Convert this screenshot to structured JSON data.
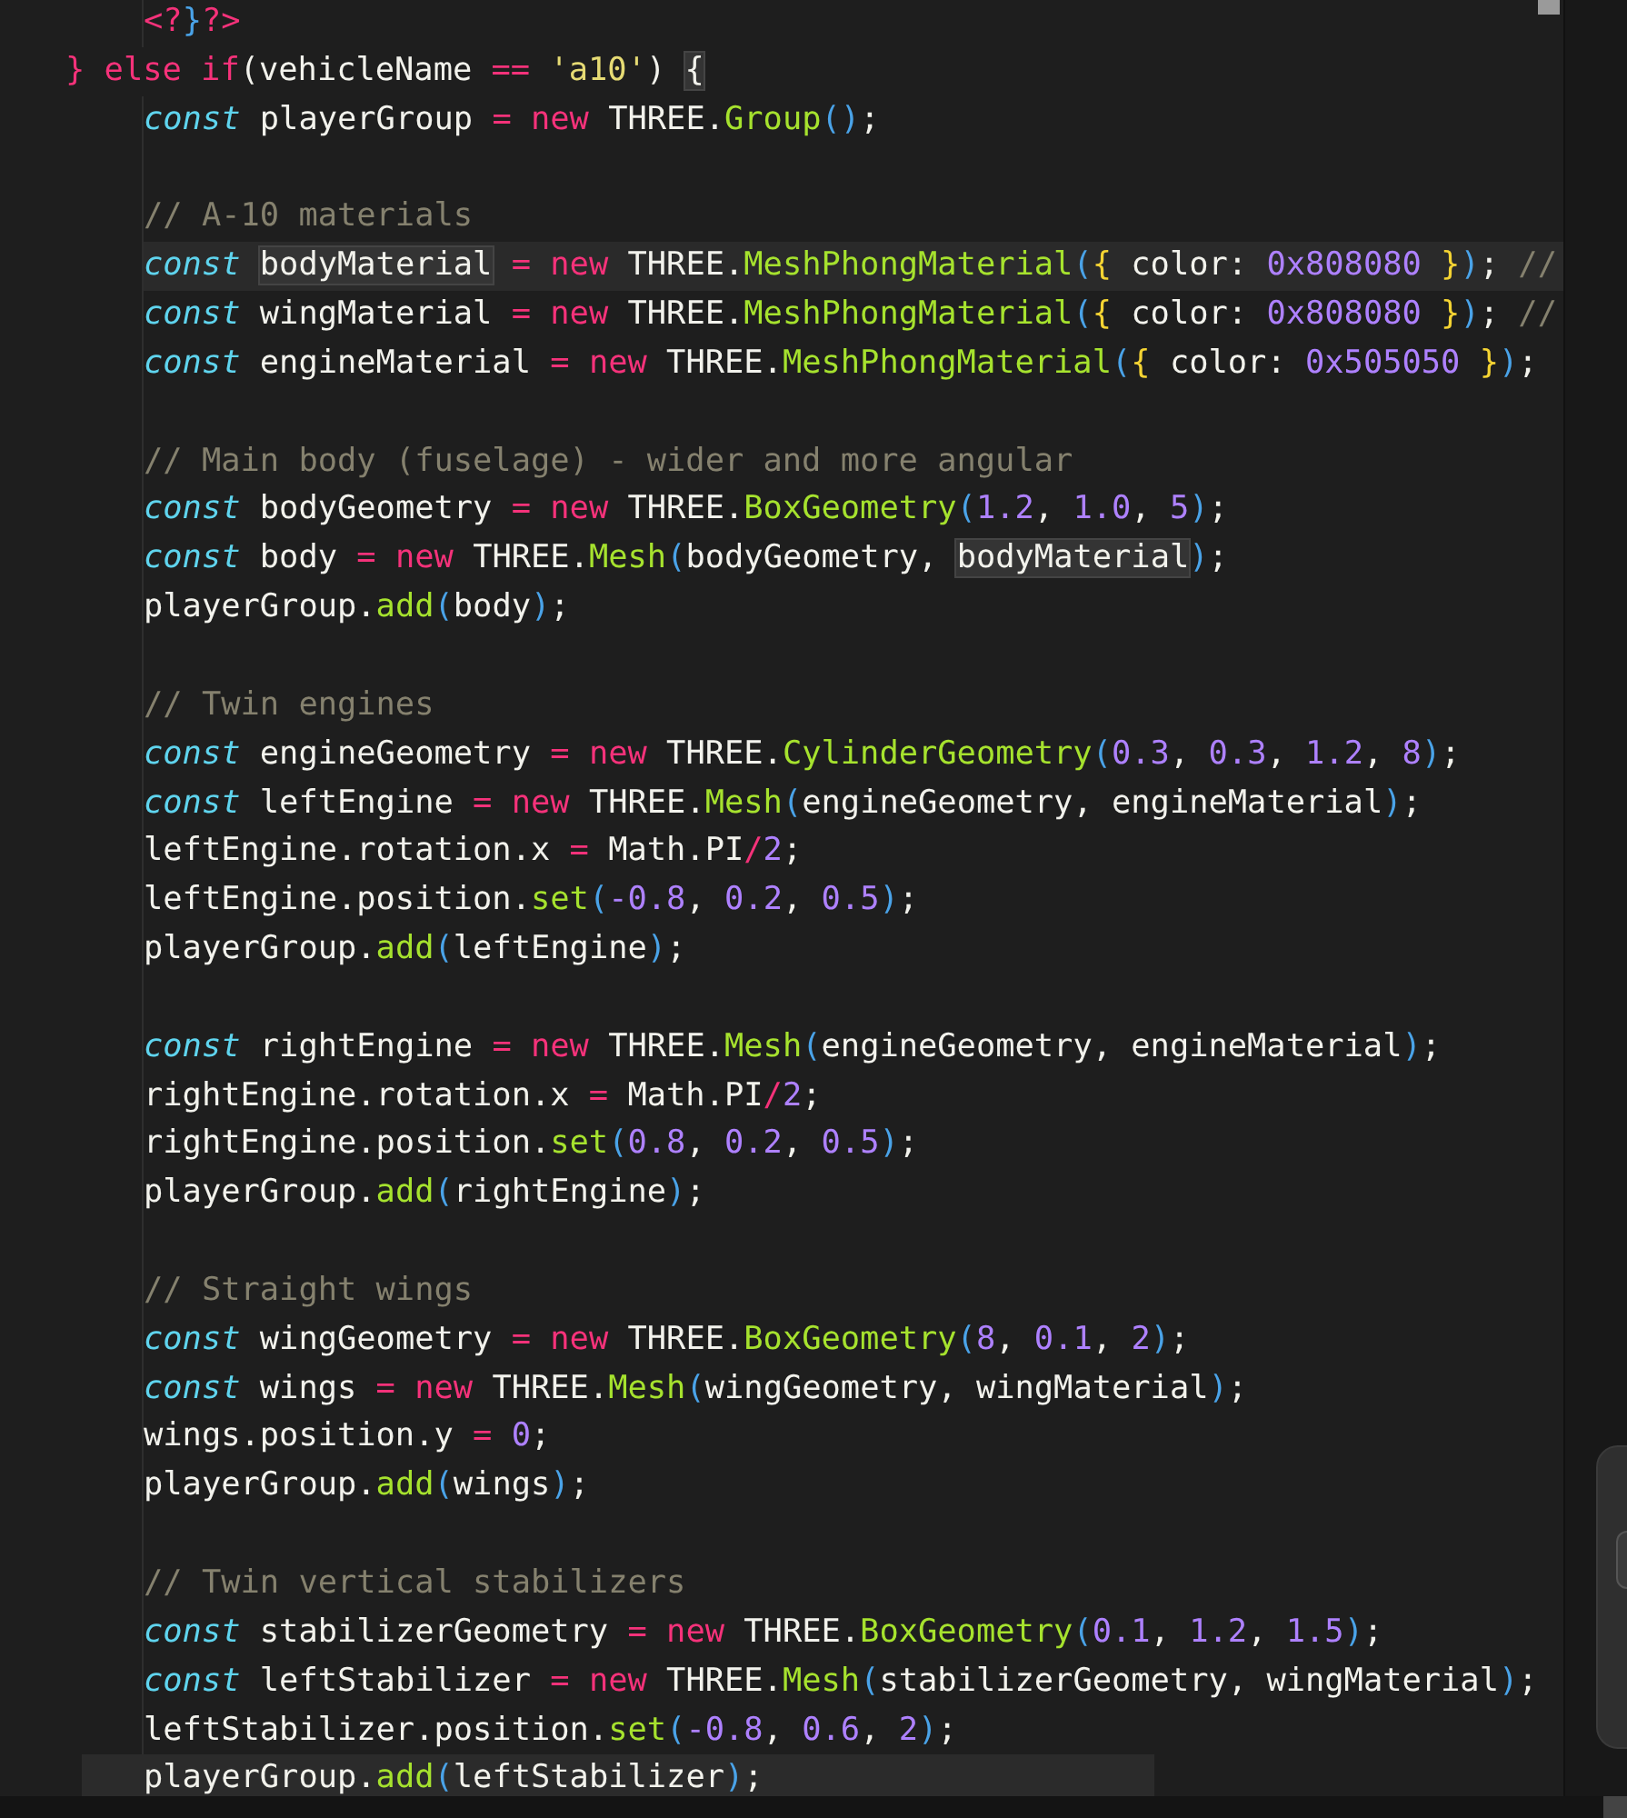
{
  "editor": {
    "preceding_block": [
      {
        "tokens": [
          {
            "t": "<?",
            "kind": "keyword"
          },
          {
            "t": "}",
            "kind": "paren"
          },
          {
            "t": "?>",
            "kind": "keyword"
          }
        ]
      }
    ],
    "lines": [
      {
        "tokens": [
          {
            "t": "} else if",
            "kind": "keyword"
          },
          {
            "t": "(vehicleName ",
            "kind": "plain"
          },
          {
            "t": "== ",
            "kind": "keyword"
          },
          {
            "t": "'a10'",
            "kind": "string"
          },
          {
            "t": ") ",
            "kind": "plain"
          },
          {
            "t": "{",
            "kind": "plain",
            "highlighted": true
          }
        ],
        "children": [
          {
            "tokens": [
              {
                "t": "const",
                "kind": "storage"
              },
              {
                "t": " playerGroup ",
                "kind": "plain"
              },
              {
                "t": "= ",
                "kind": "keyword"
              },
              {
                "t": "new",
                "kind": "keyword"
              },
              {
                "t": " THREE.",
                "kind": "plain"
              },
              {
                "t": "Group",
                "kind": "function"
              },
              {
                "t": "()",
                "kind": "paren"
              },
              {
                "t": ";",
                "kind": "plain"
              }
            ]
          },
          {
            "gap_before": true,
            "tokens": [
              {
                "t": "// A-10 materials",
                "kind": "comment"
              }
            ]
          },
          {
            "current_line": true,
            "tokens": [
              {
                "t": "const ",
                "kind": "storage"
              },
              {
                "t": "bodyMaterial",
                "kind": "plain",
                "highlighted": true
              },
              {
                "t": " = ",
                "kind": "keyword"
              },
              {
                "t": "new",
                "kind": "keyword"
              },
              {
                "t": " THREE.",
                "kind": "plain"
              },
              {
                "t": "MeshPhongMaterial",
                "kind": "function"
              },
              {
                "t": "(",
                "kind": "paren"
              },
              {
                "t": "{",
                "kind": "brace"
              },
              {
                "t": " color: ",
                "kind": "plain"
              },
              {
                "t": "0x808080 ",
                "kind": "number"
              },
              {
                "t": "}",
                "kind": "brace"
              },
              {
                "t": ")",
                "kind": "paren"
              },
              {
                "t": "; ",
                "kind": "plain"
              },
              {
                "t": "//",
                "kind": "comment"
              }
            ]
          },
          {
            "tokens": [
              {
                "t": "const",
                "kind": "storage"
              },
              {
                "t": " wingMaterial ",
                "kind": "plain"
              },
              {
                "t": "= ",
                "kind": "keyword"
              },
              {
                "t": "new",
                "kind": "keyword"
              },
              {
                "t": " THREE.",
                "kind": "plain"
              },
              {
                "t": "MeshPhongMaterial",
                "kind": "function"
              },
              {
                "t": "(",
                "kind": "paren"
              },
              {
                "t": "{",
                "kind": "brace"
              },
              {
                "t": " color: ",
                "kind": "plain"
              },
              {
                "t": "0x808080 ",
                "kind": "number"
              },
              {
                "t": "}",
                "kind": "brace"
              },
              {
                "t": ")",
                "kind": "paren"
              },
              {
                "t": "; ",
                "kind": "plain"
              },
              {
                "t": "//",
                "kind": "comment"
              }
            ]
          },
          {
            "tokens": [
              {
                "t": "const",
                "kind": "storage"
              },
              {
                "t": " engineMaterial ",
                "kind": "plain"
              },
              {
                "t": "= ",
                "kind": "keyword"
              },
              {
                "t": "new",
                "kind": "keyword"
              },
              {
                "t": " THREE.",
                "kind": "plain"
              },
              {
                "t": "MeshPhongMaterial",
                "kind": "function"
              },
              {
                "t": "(",
                "kind": "paren"
              },
              {
                "t": "{",
                "kind": "brace"
              },
              {
                "t": " color: ",
                "kind": "plain"
              },
              {
                "t": "0x505050 ",
                "kind": "number"
              },
              {
                "t": "}",
                "kind": "brace"
              },
              {
                "t": ")",
                "kind": "paren"
              },
              {
                "t": ";",
                "kind": "plain"
              }
            ]
          },
          {
            "gap_before": true,
            "tokens": [
              {
                "t": "// Main body (fuselage) - wider and more angular",
                "kind": "comment"
              }
            ]
          },
          {
            "tokens": [
              {
                "t": "const",
                "kind": "storage"
              },
              {
                "t": " bodyGeometry ",
                "kind": "plain"
              },
              {
                "t": "= ",
                "kind": "keyword"
              },
              {
                "t": "new",
                "kind": "keyword"
              },
              {
                "t": " THREE.",
                "kind": "plain"
              },
              {
                "t": "BoxGeometry",
                "kind": "function"
              },
              {
                "t": "(",
                "kind": "paren"
              },
              {
                "t": "1.2",
                "kind": "number"
              },
              {
                "t": ", ",
                "kind": "plain"
              },
              {
                "t": "1.0",
                "kind": "number"
              },
              {
                "t": ", ",
                "kind": "plain"
              },
              {
                "t": "5",
                "kind": "number"
              },
              {
                "t": ")",
                "kind": "paren"
              },
              {
                "t": ";",
                "kind": "plain"
              }
            ]
          },
          {
            "tokens": [
              {
                "t": "const",
                "kind": "storage"
              },
              {
                "t": " body ",
                "kind": "plain"
              },
              {
                "t": "= ",
                "kind": "keyword"
              },
              {
                "t": "new",
                "kind": "keyword"
              },
              {
                "t": " THREE.",
                "kind": "plain"
              },
              {
                "t": "Mesh",
                "kind": "function"
              },
              {
                "t": "(",
                "kind": "paren"
              },
              {
                "t": "bodyGeometry, ",
                "kind": "plain"
              },
              {
                "t": "bodyMaterial",
                "kind": "plain",
                "highlighted": true
              },
              {
                "t": ")",
                "kind": "paren"
              },
              {
                "t": ";",
                "kind": "plain"
              }
            ]
          },
          {
            "tokens": [
              {
                "t": "playerGroup.",
                "kind": "plain"
              },
              {
                "t": "add",
                "kind": "function"
              },
              {
                "t": "(",
                "kind": "paren"
              },
              {
                "t": "body",
                "kind": "plain"
              },
              {
                "t": ")",
                "kind": "paren"
              },
              {
                "t": ";",
                "kind": "plain"
              }
            ]
          },
          {
            "gap_before": true,
            "tokens": [
              {
                "t": "// Twin engines",
                "kind": "comment"
              }
            ]
          },
          {
            "tokens": [
              {
                "t": "const",
                "kind": "storage"
              },
              {
                "t": " engineGeometry ",
                "kind": "plain"
              },
              {
                "t": "= ",
                "kind": "keyword"
              },
              {
                "t": "new",
                "kind": "keyword"
              },
              {
                "t": " THREE.",
                "kind": "plain"
              },
              {
                "t": "CylinderGeometry",
                "kind": "function"
              },
              {
                "t": "(",
                "kind": "paren"
              },
              {
                "t": "0.3",
                "kind": "number"
              },
              {
                "t": ", ",
                "kind": "plain"
              },
              {
                "t": "0.3",
                "kind": "number"
              },
              {
                "t": ", ",
                "kind": "plain"
              },
              {
                "t": "1.2",
                "kind": "number"
              },
              {
                "t": ", ",
                "kind": "plain"
              },
              {
                "t": "8",
                "kind": "number"
              },
              {
                "t": ")",
                "kind": "paren"
              },
              {
                "t": ";",
                "kind": "plain"
              }
            ]
          },
          {
            "tokens": [
              {
                "t": "const",
                "kind": "storage"
              },
              {
                "t": " leftEngine ",
                "kind": "plain"
              },
              {
                "t": "= ",
                "kind": "keyword"
              },
              {
                "t": "new",
                "kind": "keyword"
              },
              {
                "t": " THREE.",
                "kind": "plain"
              },
              {
                "t": "Mesh",
                "kind": "function"
              },
              {
                "t": "(",
                "kind": "paren"
              },
              {
                "t": "engineGeometry, engineMaterial",
                "kind": "plain"
              },
              {
                "t": ")",
                "kind": "paren"
              },
              {
                "t": ";",
                "kind": "plain"
              }
            ]
          },
          {
            "tokens": [
              {
                "t": "leftEngine.rotation.x ",
                "kind": "plain"
              },
              {
                "t": "=",
                "kind": "keyword"
              },
              {
                "t": " Math.PI",
                "kind": "plain"
              },
              {
                "t": "/",
                "kind": "keyword"
              },
              {
                "t": "2",
                "kind": "number"
              },
              {
                "t": ";",
                "kind": "plain"
              }
            ]
          },
          {
            "tokens": [
              {
                "t": "leftEngine.position.",
                "kind": "plain"
              },
              {
                "t": "set",
                "kind": "function"
              },
              {
                "t": "(",
                "kind": "paren"
              },
              {
                "t": "-0.8",
                "kind": "number"
              },
              {
                "t": ", ",
                "kind": "plain"
              },
              {
                "t": "0.2",
                "kind": "number"
              },
              {
                "t": ", ",
                "kind": "plain"
              },
              {
                "t": "0.5",
                "kind": "number"
              },
              {
                "t": ")",
                "kind": "paren"
              },
              {
                "t": ";",
                "kind": "plain"
              }
            ]
          },
          {
            "tokens": [
              {
                "t": "playerGroup.",
                "kind": "plain"
              },
              {
                "t": "add",
                "kind": "function"
              },
              {
                "t": "(",
                "kind": "paren"
              },
              {
                "t": "leftEngine",
                "kind": "plain"
              },
              {
                "t": ")",
                "kind": "paren"
              },
              {
                "t": ";",
                "kind": "plain"
              }
            ]
          },
          {
            "gap_before": true,
            "tokens": [
              {
                "t": "const",
                "kind": "storage"
              },
              {
                "t": " rightEngine ",
                "kind": "plain"
              },
              {
                "t": "= ",
                "kind": "keyword"
              },
              {
                "t": "new",
                "kind": "keyword"
              },
              {
                "t": " THREE.",
                "kind": "plain"
              },
              {
                "t": "Mesh",
                "kind": "function"
              },
              {
                "t": "(",
                "kind": "paren"
              },
              {
                "t": "engineGeometry, engineMaterial",
                "kind": "plain"
              },
              {
                "t": ")",
                "kind": "paren"
              },
              {
                "t": ";",
                "kind": "plain"
              }
            ]
          },
          {
            "tokens": [
              {
                "t": "rightEngine.rotation.x ",
                "kind": "plain"
              },
              {
                "t": "=",
                "kind": "keyword"
              },
              {
                "t": " Math.PI",
                "kind": "plain"
              },
              {
                "t": "/",
                "kind": "keyword"
              },
              {
                "t": "2",
                "kind": "number"
              },
              {
                "t": ";",
                "kind": "plain"
              }
            ]
          },
          {
            "tokens": [
              {
                "t": "rightEngine.position.",
                "kind": "plain"
              },
              {
                "t": "set",
                "kind": "function"
              },
              {
                "t": "(",
                "kind": "paren"
              },
              {
                "t": "0.8",
                "kind": "number"
              },
              {
                "t": ", ",
                "kind": "plain"
              },
              {
                "t": "0.2",
                "kind": "number"
              },
              {
                "t": ", ",
                "kind": "plain"
              },
              {
                "t": "0.5",
                "kind": "number"
              },
              {
                "t": ")",
                "kind": "paren"
              },
              {
                "t": ";",
                "kind": "plain"
              }
            ]
          },
          {
            "tokens": [
              {
                "t": "playerGroup.",
                "kind": "plain"
              },
              {
                "t": "add",
                "kind": "function"
              },
              {
                "t": "(",
                "kind": "paren"
              },
              {
                "t": "rightEngine",
                "kind": "plain"
              },
              {
                "t": ")",
                "kind": "paren"
              },
              {
                "t": ";",
                "kind": "plain"
              }
            ]
          },
          {
            "gap_before": true,
            "tokens": [
              {
                "t": "// Straight wings",
                "kind": "comment"
              }
            ]
          },
          {
            "tokens": [
              {
                "t": "const",
                "kind": "storage"
              },
              {
                "t": " wingGeometry ",
                "kind": "plain"
              },
              {
                "t": "= ",
                "kind": "keyword"
              },
              {
                "t": "new",
                "kind": "keyword"
              },
              {
                "t": " THREE.",
                "kind": "plain"
              },
              {
                "t": "BoxGeometry",
                "kind": "function"
              },
              {
                "t": "(",
                "kind": "paren"
              },
              {
                "t": "8",
                "kind": "number"
              },
              {
                "t": ", ",
                "kind": "plain"
              },
              {
                "t": "0.1",
                "kind": "number"
              },
              {
                "t": ", ",
                "kind": "plain"
              },
              {
                "t": "2",
                "kind": "number"
              },
              {
                "t": ")",
                "kind": "paren"
              },
              {
                "t": ";",
                "kind": "plain"
              }
            ]
          },
          {
            "tokens": [
              {
                "t": "const",
                "kind": "storage"
              },
              {
                "t": " wings ",
                "kind": "plain"
              },
              {
                "t": "= ",
                "kind": "keyword"
              },
              {
                "t": "new",
                "kind": "keyword"
              },
              {
                "t": " THREE.",
                "kind": "plain"
              },
              {
                "t": "Mesh",
                "kind": "function"
              },
              {
                "t": "(",
                "kind": "paren"
              },
              {
                "t": "wingGeometry, wingMaterial",
                "kind": "plain"
              },
              {
                "t": ")",
                "kind": "paren"
              },
              {
                "t": ";",
                "kind": "plain"
              }
            ]
          },
          {
            "tokens": [
              {
                "t": "wings.position.y ",
                "kind": "plain"
              },
              {
                "t": "= ",
                "kind": "keyword"
              },
              {
                "t": "0",
                "kind": "number"
              },
              {
                "t": ";",
                "kind": "plain"
              }
            ]
          },
          {
            "tokens": [
              {
                "t": "playerGroup.",
                "kind": "plain"
              },
              {
                "t": "add",
                "kind": "function"
              },
              {
                "t": "(",
                "kind": "paren"
              },
              {
                "t": "wings",
                "kind": "plain"
              },
              {
                "t": ")",
                "kind": "paren"
              },
              {
                "t": ";",
                "kind": "plain"
              }
            ]
          },
          {
            "gap_before": true,
            "tokens": [
              {
                "t": "// Twin vertical stabilizers",
                "kind": "comment"
              }
            ]
          },
          {
            "tokens": [
              {
                "t": "const",
                "kind": "storage"
              },
              {
                "t": " stabilizerGeometry ",
                "kind": "plain"
              },
              {
                "t": "= ",
                "kind": "keyword"
              },
              {
                "t": "new",
                "kind": "keyword"
              },
              {
                "t": " THREE.",
                "kind": "plain"
              },
              {
                "t": "BoxGeometry",
                "kind": "function"
              },
              {
                "t": "(",
                "kind": "paren"
              },
              {
                "t": "0.1",
                "kind": "number"
              },
              {
                "t": ", ",
                "kind": "plain"
              },
              {
                "t": "1.2",
                "kind": "number"
              },
              {
                "t": ", ",
                "kind": "plain"
              },
              {
                "t": "1.5",
                "kind": "number"
              },
              {
                "t": ")",
                "kind": "paren"
              },
              {
                "t": ";",
                "kind": "plain"
              }
            ]
          },
          {
            "tokens": [
              {
                "t": "const",
                "kind": "storage"
              },
              {
                "t": " leftStabilizer ",
                "kind": "plain"
              },
              {
                "t": "= ",
                "kind": "keyword"
              },
              {
                "t": "new",
                "kind": "keyword"
              },
              {
                "t": " THREE.",
                "kind": "plain"
              },
              {
                "t": "Mesh",
                "kind": "function"
              },
              {
                "t": "(",
                "kind": "paren"
              },
              {
                "t": "stabilizerGeometry, wingMaterial",
                "kind": "plain"
              },
              {
                "t": ")",
                "kind": "paren"
              },
              {
                "t": ";",
                "kind": "plain"
              }
            ]
          },
          {
            "tokens": [
              {
                "t": "leftStabilizer.position.",
                "kind": "plain"
              },
              {
                "t": "set",
                "kind": "function"
              },
              {
                "t": "(",
                "kind": "paren"
              },
              {
                "t": "-0.8",
                "kind": "number"
              },
              {
                "t": ", ",
                "kind": "plain"
              },
              {
                "t": "0.6",
                "kind": "number"
              },
              {
                "t": ", ",
                "kind": "plain"
              },
              {
                "t": "2",
                "kind": "number"
              },
              {
                "t": ")",
                "kind": "paren"
              },
              {
                "t": ";",
                "kind": "plain"
              }
            ]
          },
          {
            "selection": true,
            "tokens": [
              {
                "t": "playerGroup.",
                "kind": "plain"
              },
              {
                "t": "add",
                "kind": "function"
              },
              {
                "t": "(",
                "kind": "paren"
              },
              {
                "t": "leftStabilizer",
                "kind": "plain"
              },
              {
                "t": ")",
                "kind": "paren"
              },
              {
                "t": ";",
                "kind": "plain"
              }
            ]
          }
        ]
      }
    ]
  }
}
